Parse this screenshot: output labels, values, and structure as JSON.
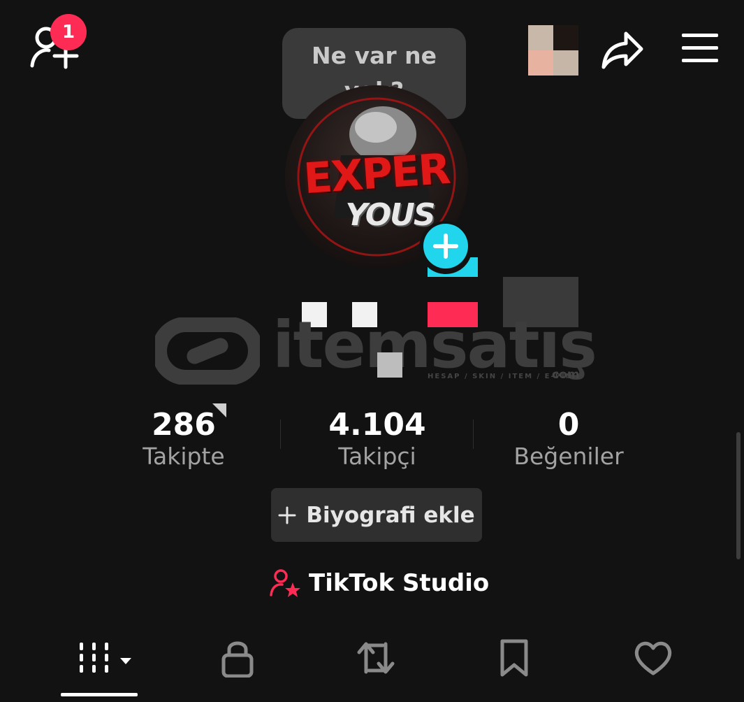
{
  "header": {
    "notification_count": "1",
    "status_bubble": "Ne var ne yok?",
    "mosaic_colors": [
      "#c8b8aa",
      "#1e1613",
      "#e8b2a0",
      "#c6b6a8"
    ]
  },
  "avatar": {
    "line1": "EXPER",
    "line2": "YOUS"
  },
  "watermark": {
    "name": "itemsatış",
    "tagline": "HESAP / SKIN / ITEM / E-PIN",
    "suffix": "com"
  },
  "stats": [
    {
      "value": "286",
      "label": "Takipte"
    },
    {
      "value": "4.104",
      "label": "Takipçi"
    },
    {
      "value": "0",
      "label": "Beğeniler"
    }
  ],
  "bio_button": {
    "icon": "plus-icon",
    "label": "Biyografi ekle"
  },
  "studio": {
    "icon": "person-star-icon",
    "label": "TikTok Studio"
  },
  "tabs": [
    {
      "name": "videos-tab",
      "icon": "grid-bars-icon",
      "active": true
    },
    {
      "name": "private-tab",
      "icon": "lock-icon",
      "active": false
    },
    {
      "name": "reposts-tab",
      "icon": "repost-icon",
      "active": false
    },
    {
      "name": "favorites-tab",
      "icon": "bookmark-icon",
      "active": false
    },
    {
      "name": "liked-tab",
      "icon": "heart-icon",
      "active": false
    }
  ],
  "colors": {
    "accent": "#fe2c55",
    "cyan": "#20d5ec",
    "background": "#121212"
  }
}
